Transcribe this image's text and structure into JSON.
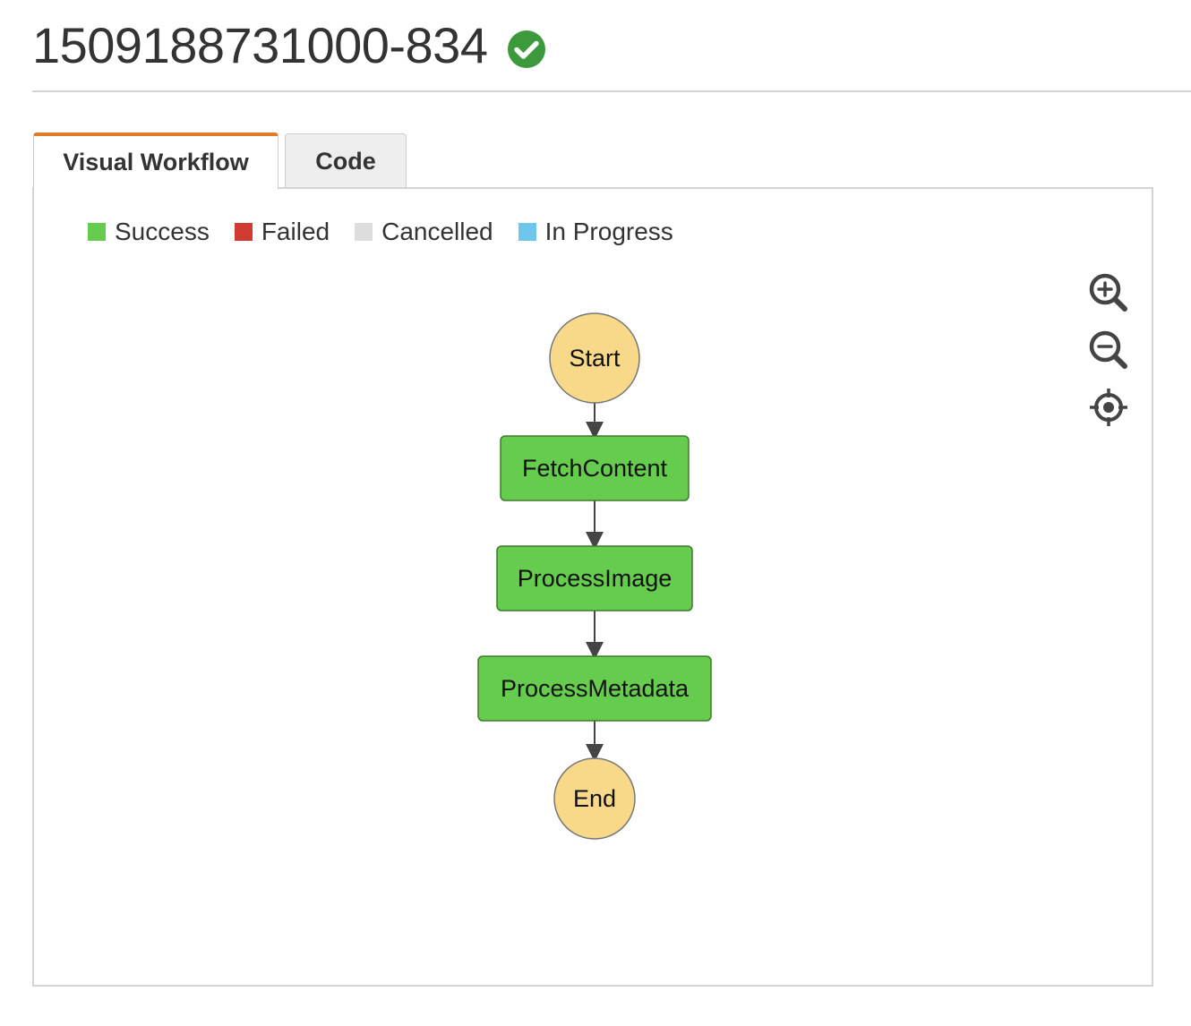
{
  "execution": {
    "title": "1509188731000-834",
    "status_icon": "check-circle-icon",
    "status_color": "#3c9a3c"
  },
  "tabs": [
    {
      "label": "Visual Workflow",
      "active": true
    },
    {
      "label": "Code",
      "active": false
    }
  ],
  "legend": [
    {
      "label": "Success",
      "color": "#66cc4d"
    },
    {
      "label": "Failed",
      "color": "#d13b32"
    },
    {
      "label": "Cancelled",
      "color": "#dddddd"
    },
    {
      "label": "In Progress",
      "color": "#6ec6ea"
    }
  ],
  "zoom_controls": [
    "zoom-in-icon",
    "zoom-out-icon",
    "center-icon"
  ],
  "workflow": {
    "nodes": [
      {
        "id": "start",
        "label": "Start",
        "kind": "terminal"
      },
      {
        "id": "fetch",
        "label": "FetchContent",
        "kind": "task",
        "status": "Success"
      },
      {
        "id": "image",
        "label": "ProcessImage",
        "kind": "task",
        "status": "Success"
      },
      {
        "id": "meta",
        "label": "ProcessMetadata",
        "kind": "task",
        "status": "Success"
      },
      {
        "id": "end",
        "label": "End",
        "kind": "terminal"
      }
    ],
    "terminal_color": "#f8d98a",
    "task_color": "#66cc4d"
  }
}
